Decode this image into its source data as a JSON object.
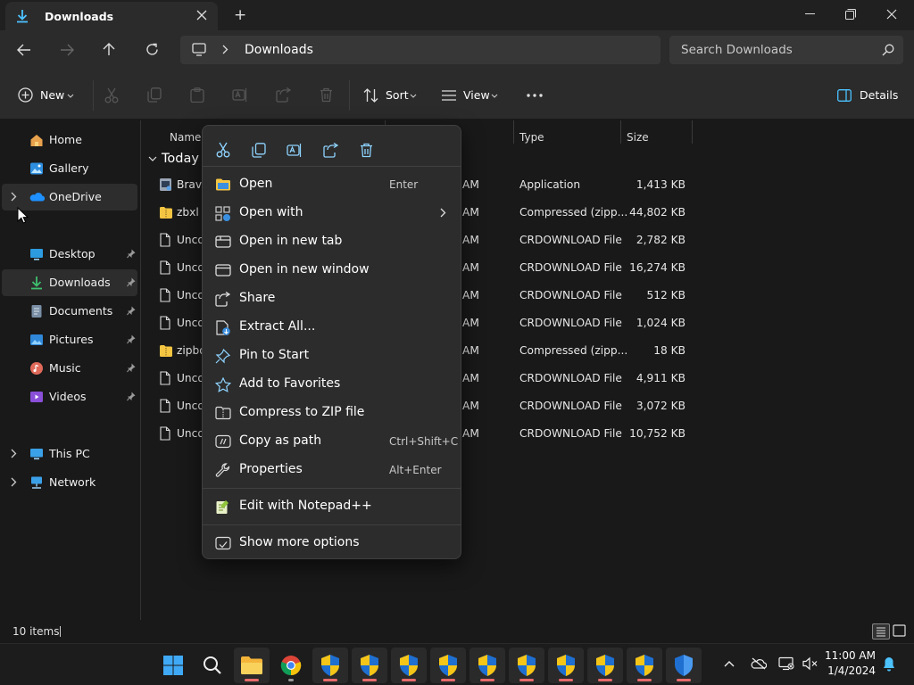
{
  "window": {
    "tab_title": "Downloads",
    "new_tab_symbol": "+"
  },
  "address_bar": {
    "path": "Downloads",
    "search_placeholder": "Search Downloads"
  },
  "command_bar": {
    "new_label": "New",
    "sort_label": "Sort",
    "view_label": "View",
    "details_label": "Details"
  },
  "sidebar": {
    "items": [
      {
        "label": "Home",
        "icon": "home-icon"
      },
      {
        "label": "Gallery",
        "icon": "gallery-icon"
      },
      {
        "label": "OneDrive",
        "icon": "onedrive-icon"
      },
      {
        "label": "Desktop",
        "icon": "desktop-icon"
      },
      {
        "label": "Downloads",
        "icon": "downloads-icon"
      },
      {
        "label": "Documents",
        "icon": "documents-icon"
      },
      {
        "label": "Pictures",
        "icon": "pictures-icon"
      },
      {
        "label": "Music",
        "icon": "music-icon"
      },
      {
        "label": "Videos",
        "icon": "videos-icon"
      },
      {
        "label": "This PC",
        "icon": "this-pc-icon"
      },
      {
        "label": "Network",
        "icon": "network-icon"
      }
    ]
  },
  "file_list": {
    "columns": {
      "name": "Name",
      "type": "Type",
      "size": "Size"
    },
    "group_label": "Today",
    "rows": [
      {
        "name": "Brave",
        "time": "AM",
        "type": "Application",
        "size": "1,413 KB",
        "icon": "app-icon"
      },
      {
        "name": "zbxl (",
        "time": "AM",
        "type": "Compressed (zipp...",
        "size": "44,802 KB",
        "icon": "zip-folder-icon"
      },
      {
        "name": "Unco",
        "time": "AM",
        "type": "CRDOWNLOAD File",
        "size": "2,782 KB",
        "icon": "file-icon"
      },
      {
        "name": "Unco",
        "time": "AM",
        "type": "CRDOWNLOAD File",
        "size": "16,274 KB",
        "icon": "file-icon"
      },
      {
        "name": "Unco",
        "time": "AM",
        "type": "CRDOWNLOAD File",
        "size": "512 KB",
        "icon": "file-icon"
      },
      {
        "name": "Unco",
        "time": "AM",
        "type": "CRDOWNLOAD File",
        "size": "1,024 KB",
        "icon": "file-icon"
      },
      {
        "name": "zipbo",
        "time": "AM",
        "type": "Compressed (zipp...",
        "size": "18 KB",
        "icon": "zip-folder-icon"
      },
      {
        "name": "Unco",
        "time": "AM",
        "type": "CRDOWNLOAD File",
        "size": "4,911 KB",
        "icon": "file-icon"
      },
      {
        "name": "Unco",
        "time": "AM",
        "type": "CRDOWNLOAD File",
        "size": "3,072 KB",
        "icon": "file-icon"
      },
      {
        "name": "Unco",
        "time": "AM",
        "type": "CRDOWNLOAD File",
        "size": "10,752 KB",
        "icon": "file-icon"
      }
    ]
  },
  "context_menu": {
    "quick_actions": [
      "cut-icon",
      "copy-icon",
      "rename-icon",
      "share-icon",
      "delete-icon"
    ],
    "items": [
      {
        "label": "Open",
        "shortcut": "Enter",
        "icon": "open-icon"
      },
      {
        "label": "Open with",
        "shortcut": "",
        "icon": "open-with-icon"
      },
      {
        "label": "Open in new tab",
        "shortcut": "",
        "icon": "new-tab-icon"
      },
      {
        "label": "Open in new window",
        "shortcut": "",
        "icon": "new-window-icon"
      },
      {
        "label": "Share",
        "shortcut": "",
        "icon": "share-icon"
      },
      {
        "label": "Extract All...",
        "shortcut": "",
        "icon": "extract-icon"
      },
      {
        "label": "Pin to Start",
        "shortcut": "",
        "icon": "pin-icon"
      },
      {
        "label": "Add to Favorites",
        "shortcut": "",
        "icon": "star-icon"
      },
      {
        "label": "Compress to ZIP file",
        "shortcut": "",
        "icon": "zip-icon"
      },
      {
        "label": "Copy as path",
        "shortcut": "Ctrl+Shift+C",
        "icon": "copy-path-icon"
      },
      {
        "label": "Properties",
        "shortcut": "Alt+Enter",
        "icon": "wrench-icon"
      },
      {
        "label": "Edit with Notepad++",
        "shortcut": "",
        "icon": "notepad-icon"
      },
      {
        "label": "Show more options",
        "shortcut": "",
        "icon": "more-options-icon"
      }
    ]
  },
  "status_bar": {
    "item_count": "10 items"
  },
  "taskbar": {
    "time": "11:00 AM",
    "date": "1/4/2024"
  },
  "colors": {
    "accent": "#4cc2ff",
    "folder": "#f4c542",
    "shield_blue": "#1f6fd1",
    "shield_yellow": "#f5c518"
  }
}
